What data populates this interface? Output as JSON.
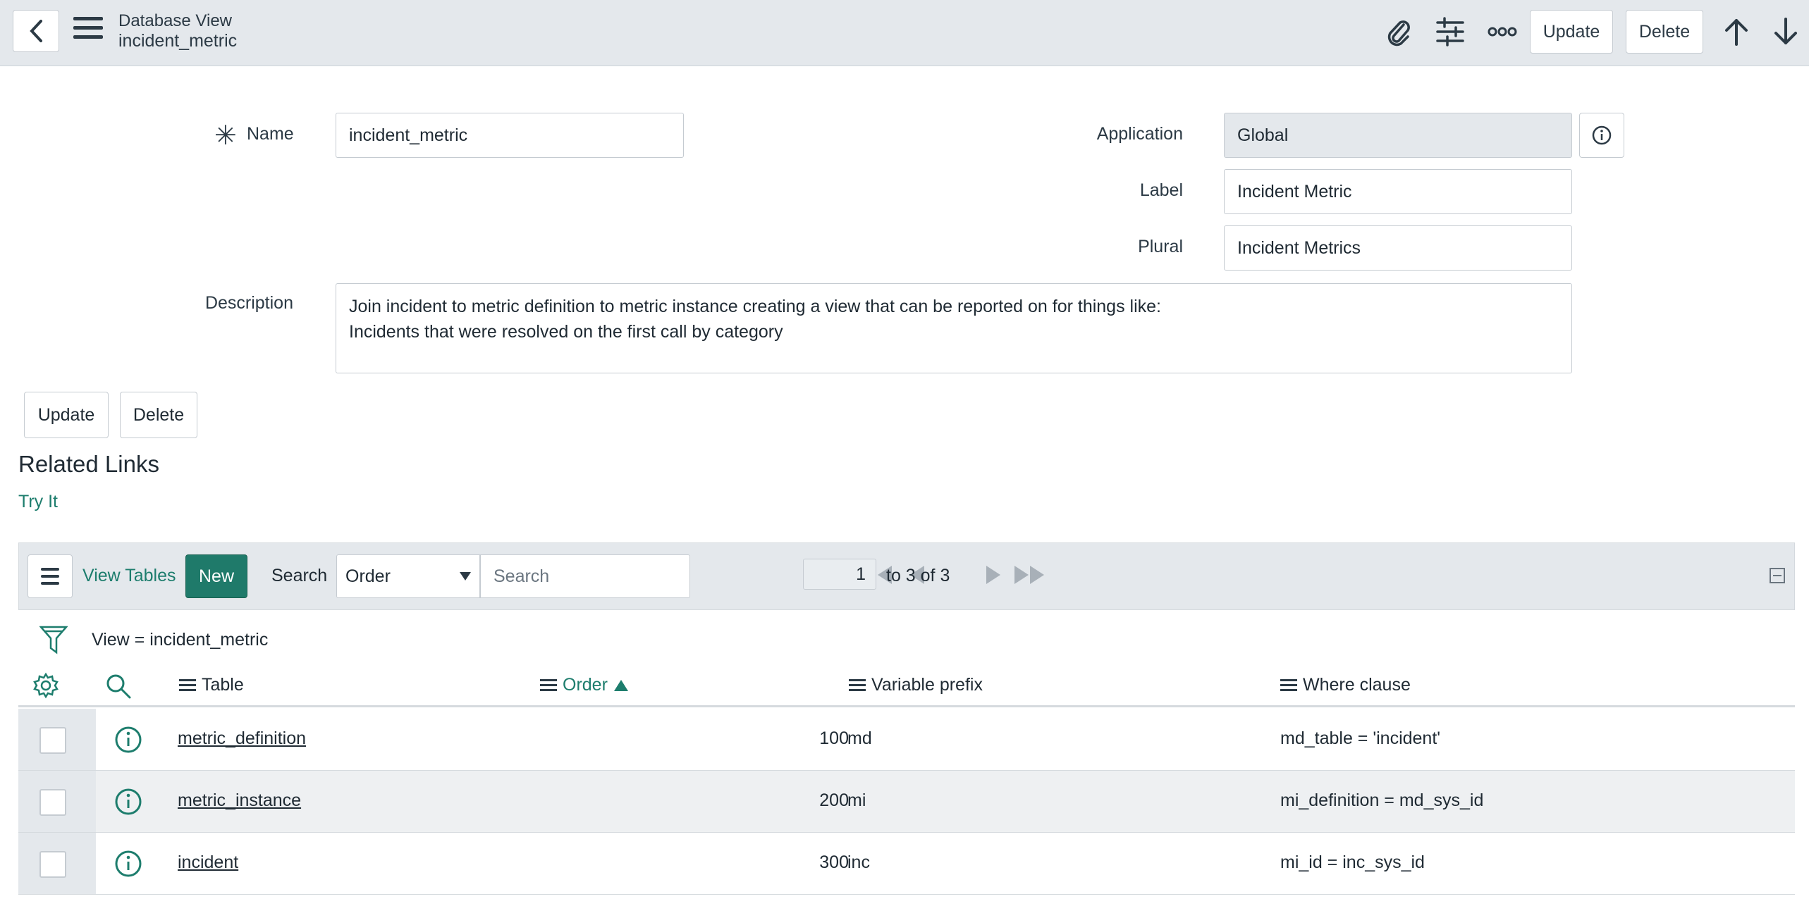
{
  "header": {
    "record_type": "Database View",
    "record_name": "incident_metric",
    "update_label": "Update",
    "delete_label": "Delete"
  },
  "form": {
    "name_label": "Name",
    "name_value": "incident_metric",
    "application_label": "Application",
    "application_value": "Global",
    "label_label": "Label",
    "label_value": "Incident Metric",
    "plural_label": "Plural",
    "plural_value": "Incident Metrics",
    "description_label": "Description",
    "description_line1": "Join incident to metric definition to metric instance creating a view that can be reported on for things like:",
    "description_line2": "Incidents that were resolved on the first call by category",
    "update_label": "Update",
    "delete_label": "Delete"
  },
  "related_links": {
    "title": "Related Links",
    "try_it": "Try It"
  },
  "list": {
    "tab_label": "View Tables",
    "new_label": "New",
    "search_label": "Search",
    "search_field": "Order",
    "search_placeholder": "Search",
    "page_value": "1",
    "page_range": "to 3 of 3",
    "filter": "View = incident_metric",
    "columns": {
      "table": "Table",
      "order": "Order",
      "variable_prefix": "Variable prefix",
      "where_clause": "Where clause"
    },
    "rows": [
      {
        "table": "metric_definition",
        "order": "100",
        "prefix": "md",
        "where": "md_table = 'incident'"
      },
      {
        "table": "metric_instance",
        "order": "200",
        "prefix": "mi",
        "where": "mi_definition = md_sys_id"
      },
      {
        "table": "incident",
        "order": "300",
        "prefix": "inc",
        "where": "mi_id = inc_sys_id"
      }
    ]
  },
  "colors": {
    "accent": "#1d7d6d",
    "new_button": "#1f7a6a",
    "header_bg": "#e4e8ec"
  }
}
